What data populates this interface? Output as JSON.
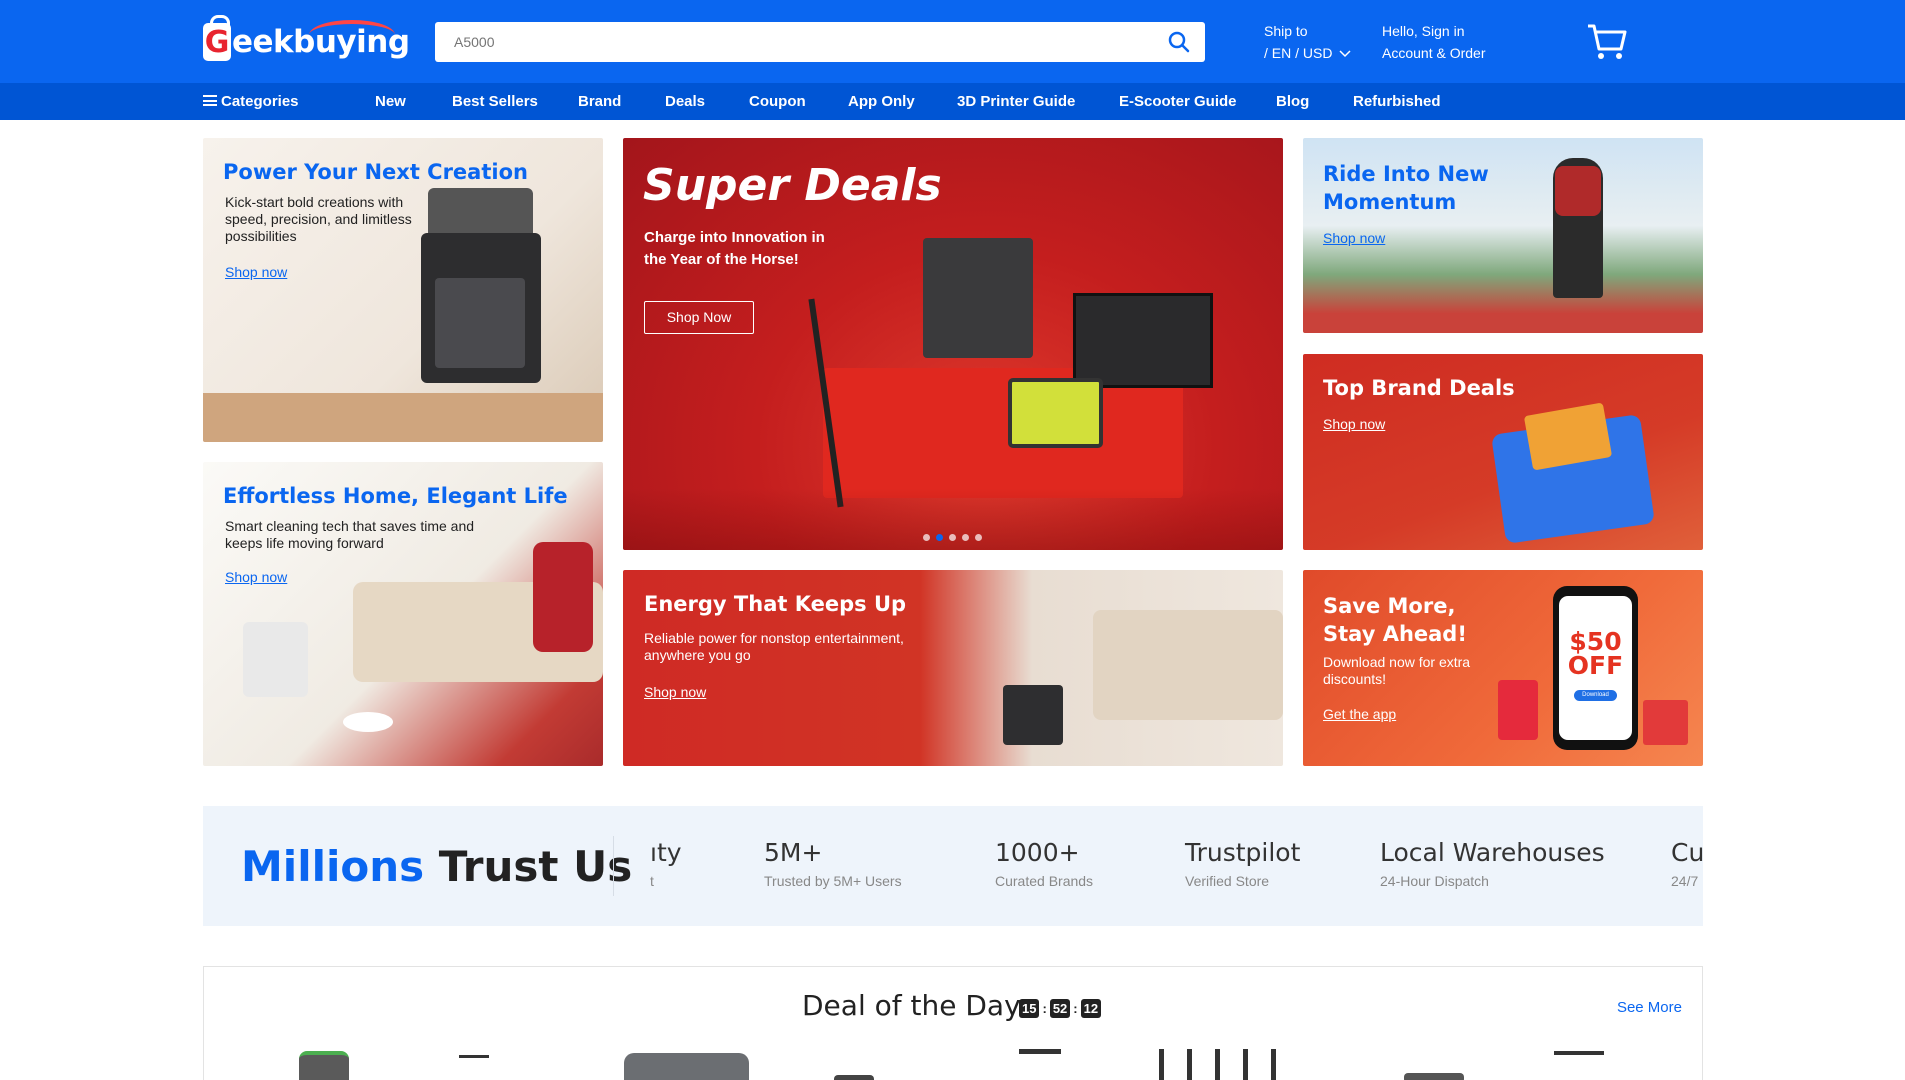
{
  "header": {
    "logo_letter": "G",
    "logo_text": "eekbuying",
    "search_placeholder": "A5000",
    "ship_line1": "Ship to",
    "ship_line2": "/ EN / USD",
    "account_line1": "Hello, Sign in",
    "account_line2": "Account & Order"
  },
  "nav": {
    "categories": "Categories",
    "items": [
      "New",
      "Best Sellers",
      "Brand",
      "Deals",
      "Coupon",
      "App Only",
      "3D Printer Guide",
      "E-Scooter Guide",
      "Blog",
      "Refurbished"
    ]
  },
  "banners": {
    "creation": {
      "title": "Power Your Next Creation",
      "sub": "Kick-start bold creations with speed, precision, and limitless possibilities",
      "link": "Shop now"
    },
    "super": {
      "title": "Super Deals",
      "sub": "Charge into Innovation in the Year of the Horse!",
      "button": "Shop Now"
    },
    "ride": {
      "title": "Ride Into New Momentum",
      "link": "Shop now"
    },
    "brand": {
      "title": "Top Brand Deals",
      "link": "Shop now"
    },
    "home": {
      "title": "Effortless Home, Elegant Life",
      "sub": "Smart cleaning tech that saves time and keeps life moving forward",
      "link": "Shop now"
    },
    "energy": {
      "title": "Energy That Keeps Up",
      "sub": "Reliable power for nonstop entertainment, anywhere you go",
      "link": "Shop now"
    },
    "app": {
      "title": "Save More, Stay Ahead!",
      "sub": "Download now for extra discounts!",
      "link": "Get the app",
      "phone_price": "$50",
      "phone_off": "OFF",
      "phone_btn": "Download"
    }
  },
  "trust": {
    "title_blue": "Millions",
    "title_dark": "Trust Us",
    "partial_left_big": "ıty",
    "partial_left_small": "t",
    "stats": [
      {
        "big": "5M+",
        "small": "Trusted by 5M+ Users"
      },
      {
        "big": "1000+",
        "small": "Curated Brands"
      },
      {
        "big": "Trustpilot",
        "small": "Verified Store"
      },
      {
        "big": "Local Warehouses",
        "small": "24-Hour Dispatch"
      },
      {
        "big": "Cu",
        "small": "24/7"
      }
    ]
  },
  "deal": {
    "title": "Deal of the Day",
    "timer": [
      "15",
      "52",
      "12"
    ],
    "see_more": "See More"
  },
  "colors": {
    "header_blue": "#0a66f0",
    "nav_blue": "#0055d4",
    "promo_red": "#c41e1e"
  }
}
